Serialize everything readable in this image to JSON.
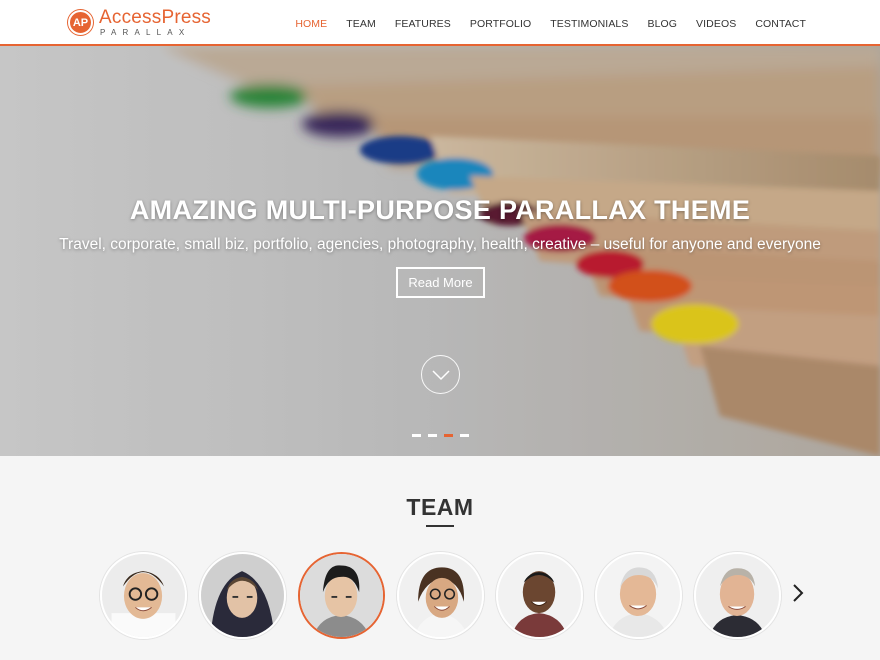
{
  "header": {
    "logo_badge": "AP",
    "logo_main": "AccessPress",
    "logo_sub": "PARALLAX",
    "nav": [
      {
        "label": "HOME",
        "active": true
      },
      {
        "label": "TEAM",
        "active": false
      },
      {
        "label": "FEATURES",
        "active": false
      },
      {
        "label": "PORTFOLIO",
        "active": false
      },
      {
        "label": "TESTIMONIALS",
        "active": false
      },
      {
        "label": "BLOG",
        "active": false
      },
      {
        "label": "VIDEOS",
        "active": false
      },
      {
        "label": "CONTACT",
        "active": false
      }
    ]
  },
  "hero": {
    "title": "AMAZING MULTI-PURPOSE PARALLAX THEME",
    "subtitle": "Travel, corporate, small biz, portfolio, agencies, photography, health, creative – useful for anyone and everyone",
    "button_label": "Read More",
    "slide_count": 4,
    "active_slide": 3,
    "scroll_icon": "chevron-down-icon"
  },
  "team": {
    "heading": "TEAM",
    "members_visible": 7,
    "active_member": 3,
    "next_icon": "chevron-right-icon"
  },
  "colors": {
    "accent": "#e66432",
    "text": "#333333",
    "section_bg": "#f5f5f5"
  }
}
